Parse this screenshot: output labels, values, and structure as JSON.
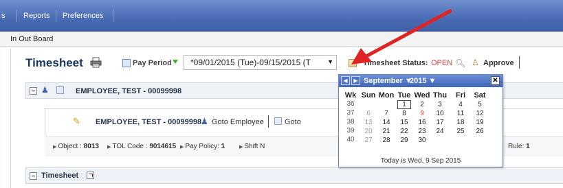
{
  "topnav": {
    "items": [
      "s",
      "Reports",
      "Preferences"
    ]
  },
  "subnav": {
    "item": "In Out Board"
  },
  "header": {
    "title": "Timesheet",
    "pay_period_label": "Pay Period",
    "pay_period_value": "*09/01/2015 (Tue)-09/15/2015 (T",
    "status_label": "Timesheet Status:",
    "status_value": "OPEN",
    "approve_label": "Approve"
  },
  "employee_panel": {
    "heading": "EMPLOYEE, TEST - 00099998",
    "card_name": "EMPLOYEE, TEST - 00099998",
    "goto_employee": "Goto Employee",
    "goto_schedule": "Goto Sc",
    "attributes": [
      {
        "label": "Object :",
        "value": "8013"
      },
      {
        "label": "TOL Code :",
        "value": "9014615"
      },
      {
        "label": "Pay Policy:",
        "value": "1"
      },
      {
        "label": "Shift N",
        "value": ""
      },
      {
        "label": "Rule:",
        "value": "1"
      }
    ]
  },
  "timesheet_panel": {
    "heading": "Timesheet"
  },
  "calendar": {
    "month": "September",
    "year": "2015",
    "week_header": "Wk",
    "days_of_week": [
      "Sun",
      "Mon",
      "Tue",
      "Wed",
      "Thu",
      "Fri",
      "Sat"
    ],
    "weeks": [
      {
        "wk": "36",
        "days": [
          "",
          "",
          "1",
          "2",
          "3",
          "4",
          "5"
        ]
      },
      {
        "wk": "37",
        "days": [
          "6",
          "7",
          "8",
          "9",
          "10",
          "11",
          "12"
        ]
      },
      {
        "wk": "38",
        "days": [
          "13",
          "14",
          "15",
          "16",
          "17",
          "18",
          "19"
        ]
      },
      {
        "wk": "39",
        "days": [
          "20",
          "21",
          "22",
          "23",
          "24",
          "25",
          "26"
        ]
      },
      {
        "wk": "40",
        "days": [
          "27",
          "28",
          "29",
          "30",
          "",
          "",
          ""
        ]
      }
    ],
    "selected_day": "1",
    "today_day": "9",
    "footer": "Today is Wed, 9 Sep 2015",
    "close_label": "✕"
  },
  "colors": {
    "nav_blue": "#4a6cb4",
    "status_red": "#e03f3f",
    "arrow_red": "#e02424"
  }
}
